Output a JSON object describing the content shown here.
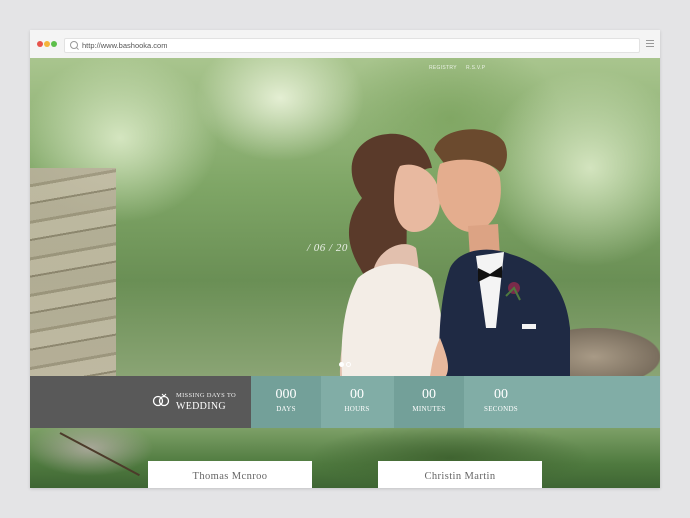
{
  "browser": {
    "url": "http://www.bashooka.com"
  },
  "hero": {
    "nav": [
      "REGISTRY",
      "R.S.V.P"
    ],
    "date": "/ 06 / 20"
  },
  "countdown": {
    "line1": "MISSING DAYS TO",
    "line2": "WEDDING",
    "units": [
      {
        "value": "000",
        "label": "DAYS"
      },
      {
        "value": "00",
        "label": "HOURS"
      },
      {
        "value": "00",
        "label": "MINUTES"
      },
      {
        "value": "00",
        "label": "SECONDS"
      }
    ]
  },
  "couple": {
    "groom": "Thomas Mcnroo",
    "bride": "Christin Martin"
  },
  "colors": {
    "accent": "#81ada6",
    "dark": "#595959"
  }
}
